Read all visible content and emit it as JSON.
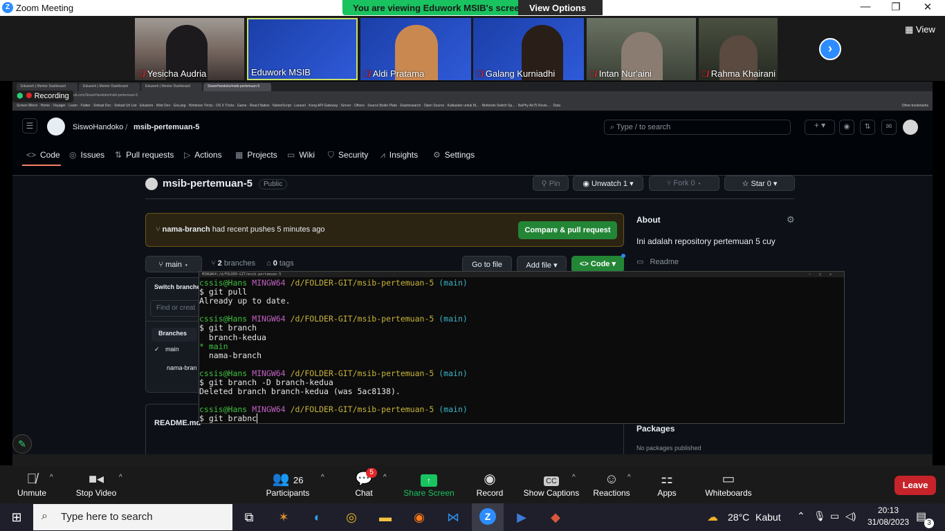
{
  "window": {
    "title": "Zoom Meeting",
    "min": "—",
    "max": "❐",
    "close": "✕"
  },
  "banner": {
    "text": "You are viewing Eduwork MSIB's screen",
    "view_options": "View Options"
  },
  "participants": [
    {
      "name": "Yesicha Audria",
      "muted": true
    },
    {
      "name": "Eduwork MSIB",
      "muted": false
    },
    {
      "name": "Aldi Pratama",
      "muted": true
    },
    {
      "name": "Galang Kurniadhi",
      "muted": true
    },
    {
      "name": "Intan Nur'aini",
      "muted": true
    },
    {
      "name": "Rahma Khairani",
      "muted": true
    }
  ],
  "view_label": "View",
  "recording": "Recording",
  "browser": {
    "tabs": [
      "Eduwork | Mentor Dashboard",
      "Eduwork | Mentor Dashboard",
      "Eduwork | Mentor Dashboard",
      "SiswoHandoko/msib-pertemuan-5"
    ],
    "url": "github.com/SiswoHandoko/msib-pertemuan-5",
    "bookmarks": "Screen Mirror · Home · Voyager · Learn · Flutter · Sinkad Doc · Sinkad Url List · Eduwork · Web Dev · GoLang · Windows Tricks · OS X Tricks · Game · React Native · NativeScript · Laravel · Kong API Gateway · Server · Others · Source Boiler Plate · Elasticsearch · Open Source · Kalkulator untuk M... · Nintendo Switch Sp... · NuPhy Air75 Revie... · Data",
    "bookmarks_right": "Other bookmarks"
  },
  "github": {
    "owner": "SiswoHandoko",
    "sep": "/",
    "repo": "msib-pertemuan-5",
    "search_placeholder": "Type / to search",
    "tabs": [
      "Code",
      "Issues",
      "Pull requests",
      "Actions",
      "Projects",
      "Wiki",
      "Security",
      "Insights",
      "Settings"
    ],
    "visibility": "Public",
    "pin": "Pin",
    "unwatch": "Unwatch",
    "unwatch_count": "1",
    "fork": "Fork",
    "fork_count": "0",
    "star": "Star",
    "star_count": "0",
    "push_branch": "nama-branch",
    "push_text": "had recent pushes 5 minutes ago",
    "compare_btn": "Compare & pull request",
    "branch_btn": "main",
    "branches_count": "2",
    "branches_label": "branches",
    "tags_count": "0",
    "tags_label": "tags",
    "goto_file": "Go to file",
    "add_file": "Add file",
    "code_btn": "Code",
    "about_title": "About",
    "about_text": "Ini adalah repository pertemuan 5 cuy",
    "readme_link": "Readme",
    "switch_title": "Switch branches",
    "find_placeholder": "Find or creat",
    "branches_tab": "Branches",
    "branch_items": [
      "main",
      "nama-bran"
    ],
    "readme_file": "README.md",
    "packages_title": "Packages",
    "packages_text": "No packages published"
  },
  "terminal": {
    "title": "MINGW64:/d/FOLDER-GIT/msib-pertemuan-5",
    "user": "cssis@Hans",
    "env": "MINGW64",
    "path": "/d/FOLDER-GIT/msib-pertemuan-5",
    "branch": "(main)",
    "cmd1": "$ git pull",
    "out1": "Already up to date.",
    "cmd2": "$ git branch",
    "b1": "  branch-kedua",
    "b2": "* main",
    "b3": "  nama-branch",
    "cmd3": "$ git branch -D branch-kedua",
    "out3": "Deleted branch branch-kedua (was 5ac8138).",
    "cmd4": "$ git brabnc"
  },
  "toolbar": {
    "unmute": "Unmute",
    "stop_video": "Stop Video",
    "participants": "Participants",
    "participants_count": "26",
    "chat": "Chat",
    "chat_badge": "5",
    "share_screen": "Share Screen",
    "record": "Record",
    "captions": "Show Captions",
    "reactions": "Reactions",
    "apps": "Apps",
    "whiteboards": "Whiteboards",
    "leave": "Leave"
  },
  "taskbar": {
    "search_placeholder": "Type here to search",
    "temperature": "28°C",
    "weather": "Kabut",
    "time": "20:13",
    "date": "31/08/2023",
    "notifications": "3"
  },
  "colors": {
    "zoom_blue": "#2d8cff",
    "share_green": "#19c35f",
    "leave_red": "#c7232a",
    "gh_green": "#238636"
  }
}
